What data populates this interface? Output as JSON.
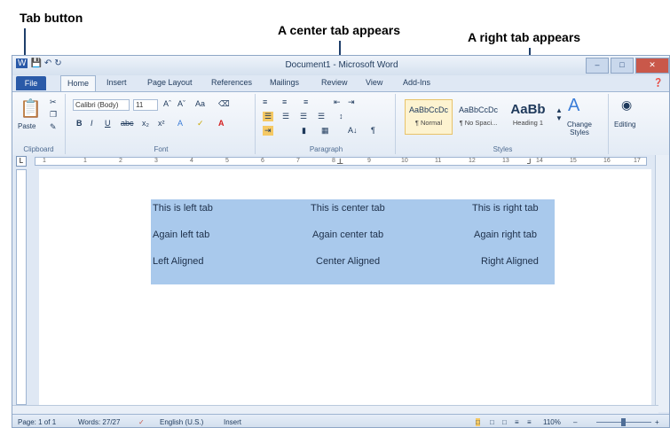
{
  "annotations": {
    "tab_button": "Tab button",
    "center_tab": "A center tab appears",
    "right_tab": "A right tab appears"
  },
  "window": {
    "title": "Document1 - Microsoft Word",
    "minimize": "–",
    "maximize": "□",
    "close": "✕"
  },
  "menu_tabs": [
    "File",
    "Home",
    "Insert",
    "Page Layout",
    "References",
    "Mailings",
    "Review",
    "View",
    "Add-Ins"
  ],
  "ribbon": {
    "clipboard": {
      "paste": "Paste",
      "label": "Clipboard"
    },
    "font": {
      "name": "Calibri (Body)",
      "size": "11",
      "label": "Font",
      "bold": "B",
      "italic": "I",
      "underline": "U",
      "strike": "abc"
    },
    "paragraph": {
      "label": "Paragraph",
      "pilcrow": "¶",
      "sort": "A↓"
    },
    "styles": {
      "label": "Styles",
      "items": [
        {
          "sample": "AaBbCcDc",
          "name": "¶ Normal"
        },
        {
          "sample": "AaBbCcDc",
          "name": "¶ No Spaci..."
        },
        {
          "sample": "AaBb",
          "name": "Heading 1"
        }
      ],
      "change_styles": "Change Styles",
      "editing": "Editing"
    }
  },
  "ruler": {
    "numbers": [
      "1",
      "1",
      "2",
      "3",
      "4",
      "5",
      "6",
      "7",
      "8",
      "9",
      "10",
      "11",
      "12",
      "13",
      "14",
      "15",
      "16",
      "17"
    ],
    "tab_selector": "L"
  },
  "document": {
    "rows": [
      {
        "left": "This is left tab",
        "center": "This is center tab",
        "right": "This is right tab"
      },
      {
        "left": "Again left tab",
        "center": "Again center tab",
        "right": "Again right tab"
      },
      {
        "left": "Left Aligned",
        "center": "Center Aligned",
        "right": "Right Aligned"
      }
    ]
  },
  "status_bar": {
    "page": "Page: 1 of 1",
    "words": "Words: 27/27",
    "language": "English (U.S.)",
    "mode": "Insert",
    "zoom": "110%",
    "zoom_minus": "–",
    "zoom_plus": "+"
  }
}
